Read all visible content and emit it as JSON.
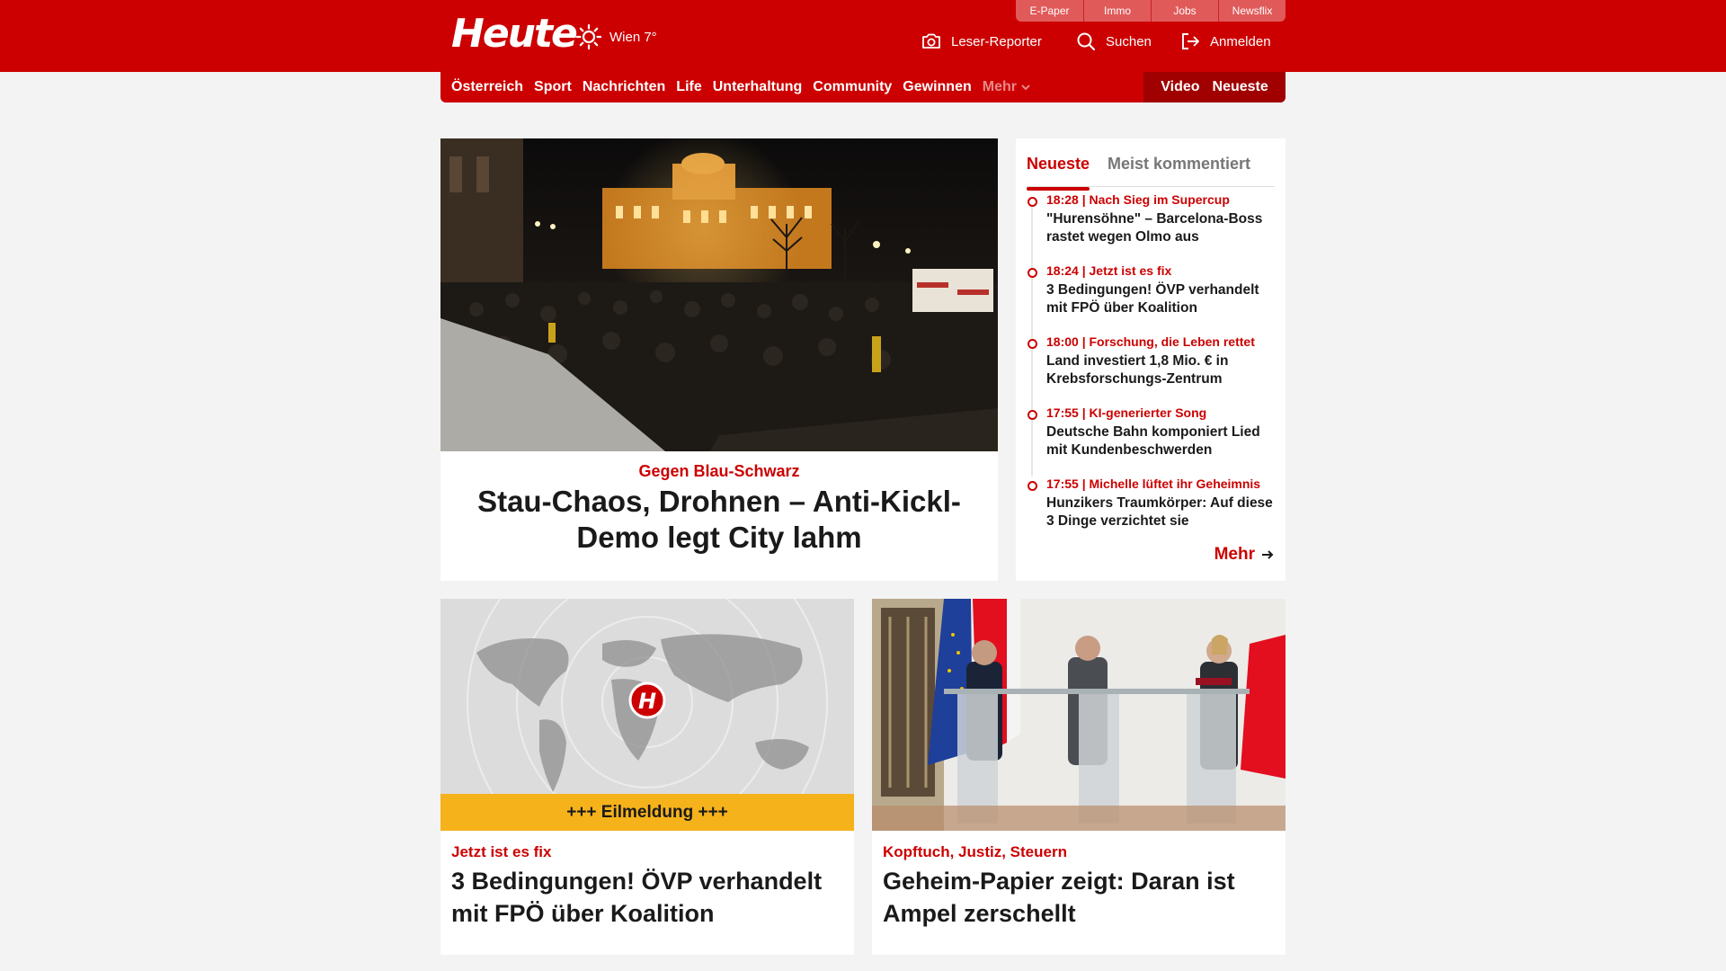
{
  "header": {
    "logo_text": "Heute",
    "weather": {
      "icon": "sun-icon",
      "text": "Wien 7°"
    },
    "top_links": [
      "E-Paper",
      "Immo",
      "Jobs",
      "Newsflix"
    ],
    "actions": {
      "reporter": "Leser-Reporter",
      "search": "Suchen",
      "login": "Anmelden"
    }
  },
  "nav": {
    "items": [
      "Österreich",
      "Sport",
      "Nachrichten",
      "Life",
      "Unterhaltung",
      "Community",
      "Gewinnen"
    ],
    "more": "Mehr",
    "right": [
      "Video",
      "Neueste"
    ]
  },
  "hero": {
    "kicker": "Gegen Blau-Schwarz",
    "title": "Stau-Chaos, Drohnen – Anti-Kickl-Demo legt City lahm"
  },
  "sidebar": {
    "tabs": [
      "Neueste",
      "Meist kommentiert"
    ],
    "items": [
      {
        "meta": "18:28 | Nach Sieg im Supercup",
        "title": "\"Hurensöhne\" – Barcelona-Boss rastet wegen Olmo aus"
      },
      {
        "meta": "18:24 | Jetzt ist es fix",
        "title": "3 Bedingungen! ÖVP verhandelt mit FPÖ über Koalition"
      },
      {
        "meta": "18:00 | Forschung, die Leben rettet",
        "title": "Land investiert 1,8 Mio. € in Krebsforschungs-Zentrum"
      },
      {
        "meta": "17:55 | KI-generierter Song",
        "title": "Deutsche Bahn komponiert Lied mit Kundenbeschwerden"
      },
      {
        "meta": "17:55 | Michelle lüftet ihr Geheimnis",
        "title": "Hunzikers Traumkörper: Auf diese 3 Dinge verzichtet sie"
      }
    ],
    "more": "Mehr"
  },
  "cards": [
    {
      "banner": "+++ Eilmeldung +++",
      "logo_letter": "H",
      "kicker": "Jetzt ist es fix",
      "title": "3 Bedingungen! ÖVP verhandelt mit FPÖ über Koalition"
    },
    {
      "kicker": "Kopftuch, Justiz, Steuern",
      "title": "Geheim-Papier zeigt: Daran ist Ampel zerschellt"
    }
  ],
  "colors": {
    "brand_red": "#cc0000",
    "dark_red": "#a00000",
    "banner_yellow": "#f5b21b",
    "page_bg": "#f3f3f3"
  }
}
